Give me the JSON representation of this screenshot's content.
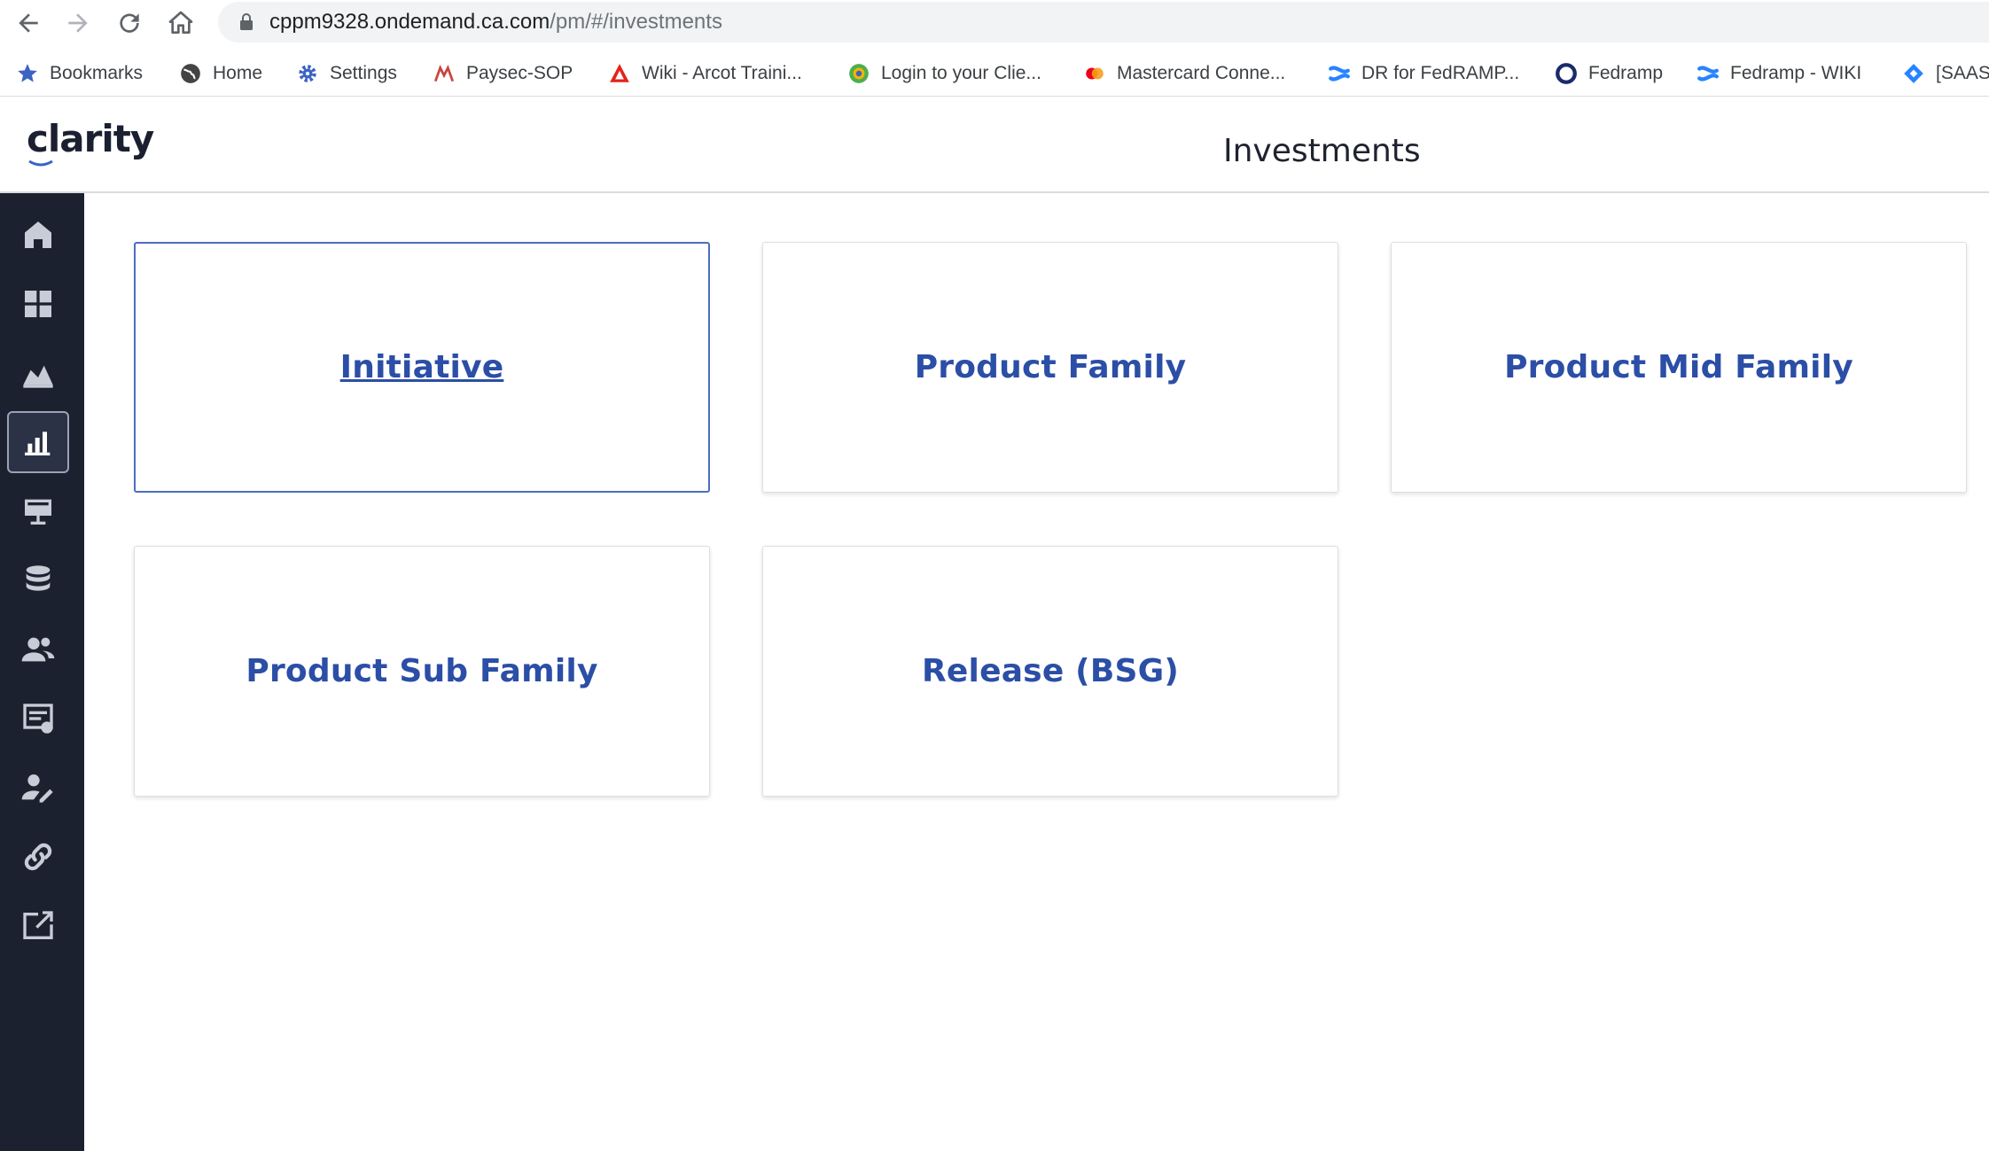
{
  "browser": {
    "url_host": "cppm9328.ondemand.ca.com",
    "url_path": "/pm/#/investments",
    "bookmarks": [
      {
        "label": "Bookmarks",
        "icon": "star-icon"
      },
      {
        "label": "Home",
        "icon": "globe-icon"
      },
      {
        "label": "Settings",
        "icon": "gear-icon"
      },
      {
        "label": "Paysec-SOP",
        "icon": "paysec-icon"
      },
      {
        "label": "Wiki - Arcot Traini...",
        "icon": "wiki-icon"
      },
      {
        "label": "Login to your Clie...",
        "icon": "client-login-icon"
      },
      {
        "label": "Mastercard Conne...",
        "icon": "mastercard-icon"
      },
      {
        "label": "DR for FedRAMP...",
        "icon": "confluence-icon"
      },
      {
        "label": "Fedramp",
        "icon": "fedramp-icon"
      },
      {
        "label": "Fedramp - WIKI",
        "icon": "confluence-icon"
      },
      {
        "label": "[SAAS",
        "icon": "jira-icon"
      }
    ]
  },
  "app": {
    "logo_text": "clarity",
    "page_title": "Investments"
  },
  "sidebar": {
    "items": [
      {
        "name": "home-icon",
        "active": false
      },
      {
        "name": "dashboard-grid-icon",
        "active": false
      },
      {
        "name": "area-chart-icon",
        "active": false
      },
      {
        "name": "bar-chart-icon",
        "active": true
      },
      {
        "name": "monitor-icon",
        "active": false
      },
      {
        "name": "database-icon",
        "active": false
      },
      {
        "name": "people-icon",
        "active": false
      },
      {
        "name": "list-document-icon",
        "active": false
      },
      {
        "name": "person-edit-icon",
        "active": false
      },
      {
        "name": "link-icon",
        "active": false
      },
      {
        "name": "external-open-icon",
        "active": false
      }
    ]
  },
  "cards": [
    {
      "label": "Initiative",
      "focused": true
    },
    {
      "label": "Product Family",
      "focused": false
    },
    {
      "label": "Product Mid Family",
      "focused": false
    },
    {
      "label": "Product Sub Family",
      "focused": false
    },
    {
      "label": "Release (BSG)",
      "focused": false
    }
  ],
  "colors": {
    "sidebar_bg": "#1c2130",
    "card_label": "#2b4ea6",
    "focus_border": "#4c6ec2"
  }
}
